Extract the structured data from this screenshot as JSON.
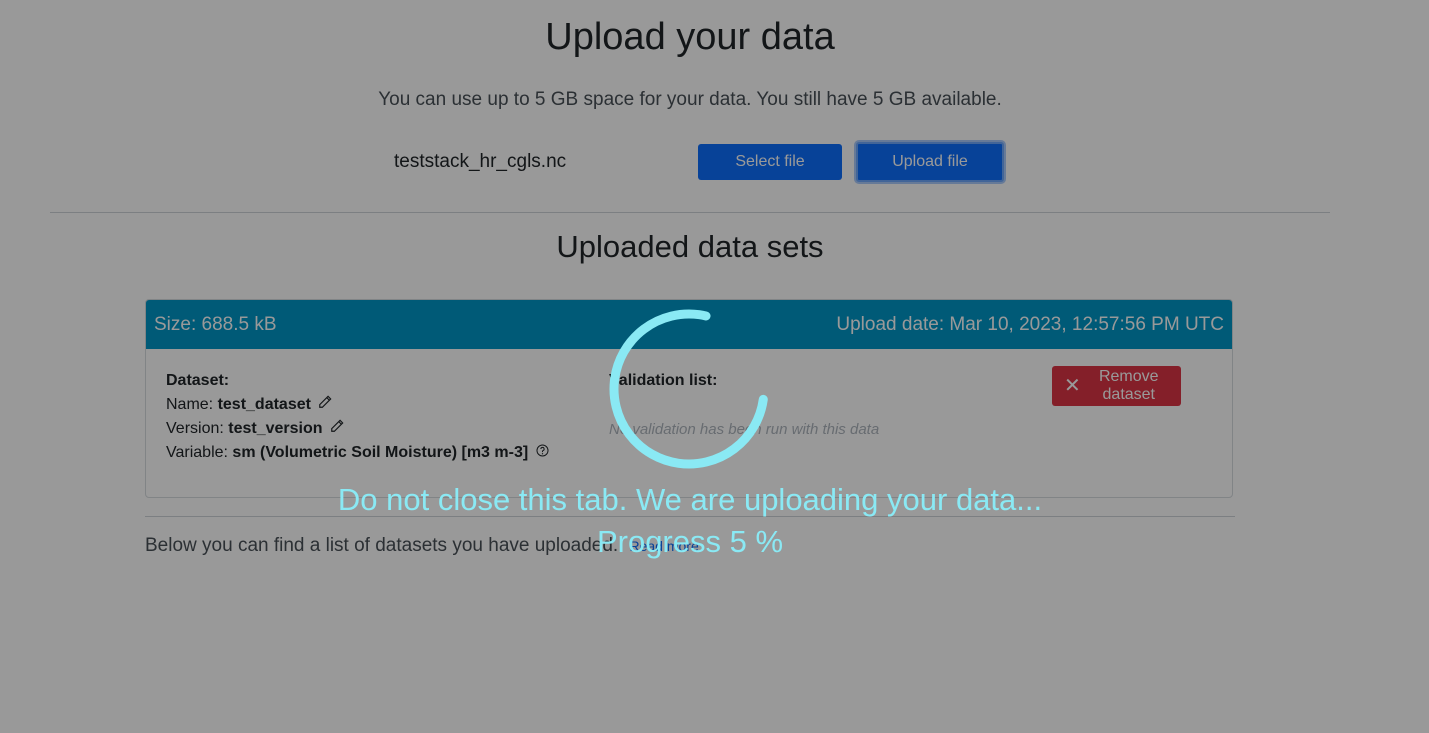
{
  "header": {
    "title": "Upload your data",
    "quota_text": "You can use up to 5 GB space for your data. You still have 5 GB available."
  },
  "upload_form": {
    "selected_file": "teststack_hr_cgls.nc",
    "select_label": "Select file",
    "upload_label": "Upload file"
  },
  "datasets": {
    "title": "Uploaded data sets",
    "items": [
      {
        "size": "Size: 688.5 kB",
        "upload_date": "Upload date: Mar 10, 2023, 12:57:56 PM UTC",
        "dataset_heading": "Dataset:",
        "name_label": "Name:",
        "name_value": "test_dataset",
        "version_label": "Version:",
        "version_value": "test_version",
        "variable_label": "Variable:",
        "variable_value": "sm (Volumetric Soil Moisture) [m3 m-3]",
        "validation_heading": "Validation list:",
        "validation_empty": "No validation has been run with this data",
        "remove_label": "Remove dataset"
      }
    ],
    "below_text": "Below you can find a list of datasets you have uploaded.",
    "read_more": "Read more"
  },
  "overlay": {
    "message": "Do not close this tab. We are uploading your data...",
    "progress_text": "Progress 5 %",
    "progress_value": 5,
    "color": "#8ae9f4"
  },
  "colors": {
    "primary": "#0d6efd",
    "card_header": "#0096c7",
    "danger": "#dc3545"
  }
}
